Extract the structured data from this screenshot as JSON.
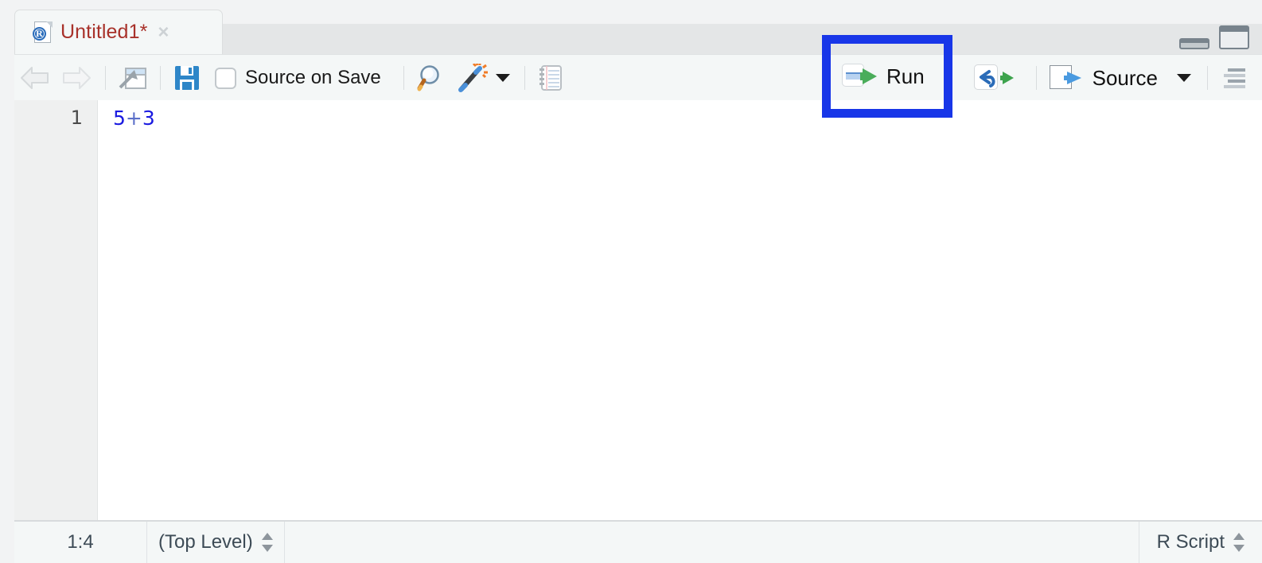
{
  "window": {
    "minimize_icon": "minimize-pane-icon",
    "maximize_icon": "maximize-pane-icon"
  },
  "tab": {
    "title": "Untitled1*",
    "close_label": "×",
    "file_icon": "r-script-file-icon",
    "icon_letter": "R"
  },
  "toolbar": {
    "back_icon": "back-arrow-icon",
    "forward_icon": "forward-arrow-icon",
    "popout_icon": "show-in-new-window-icon",
    "save_icon": "save-disk-icon",
    "source_on_save_label": "Source on Save",
    "source_on_save_checked": false,
    "find_icon": "magnifier-find-icon",
    "code_tools_icon": "magic-wand-code-tools-icon",
    "code_tools_caret": "chevron-down-icon",
    "compile_report_icon": "notebook-compile-report-icon",
    "run_label": "Run",
    "run_icon": "run-line-icon",
    "rerun_icon": "rerun-previous-icon",
    "source_label": "Source",
    "source_icon": "source-document-icon",
    "source_caret": "chevron-down-icon",
    "outline_icon": "document-outline-icon"
  },
  "highlight": {
    "target": "run-button",
    "color": "#1836e8"
  },
  "editor": {
    "lines": [
      {
        "number": "1",
        "code_left": "5",
        "code_op": "+",
        "code_right": "3"
      }
    ]
  },
  "statusbar": {
    "cursor_position": "1:4",
    "scope": "(Top Level)",
    "scope_stepper": "up-down-stepper-icon",
    "file_type": "R Script",
    "file_type_stepper": "up-down-stepper-icon"
  },
  "colors": {
    "tab_title": "#a8312a",
    "code_text": "#1a1ae0",
    "highlight_blue": "#1836e8",
    "toolbar_bg": "#f4f7f7",
    "gutter_bg": "#eff0f0"
  }
}
